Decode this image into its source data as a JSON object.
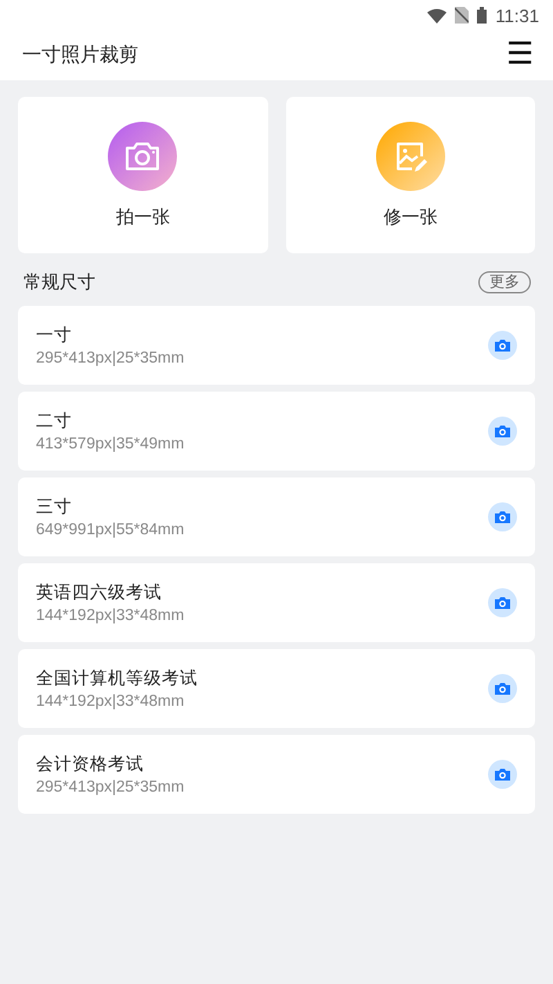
{
  "status_bar": {
    "time": "11:31"
  },
  "app_bar": {
    "title": "一寸照片裁剪",
    "menu_icon": "☰"
  },
  "actions": [
    {
      "kind": "camera",
      "label": "拍一张"
    },
    {
      "kind": "edit",
      "label": "修一张"
    }
  ],
  "section": {
    "title": "常规尺寸",
    "more": "更多"
  },
  "sizes": [
    {
      "name": "一寸",
      "spec": "295*413px|25*35mm"
    },
    {
      "name": "二寸",
      "spec": "413*579px|35*49mm"
    },
    {
      "name": "三寸",
      "spec": "649*991px|55*84mm"
    },
    {
      "name": "英语四六级考试",
      "spec": "144*192px|33*48mm"
    },
    {
      "name": "全国计算机等级考试",
      "spec": "144*192px|33*48mm"
    },
    {
      "name": "会计资格考试",
      "spec": "295*413px|25*35mm"
    }
  ]
}
